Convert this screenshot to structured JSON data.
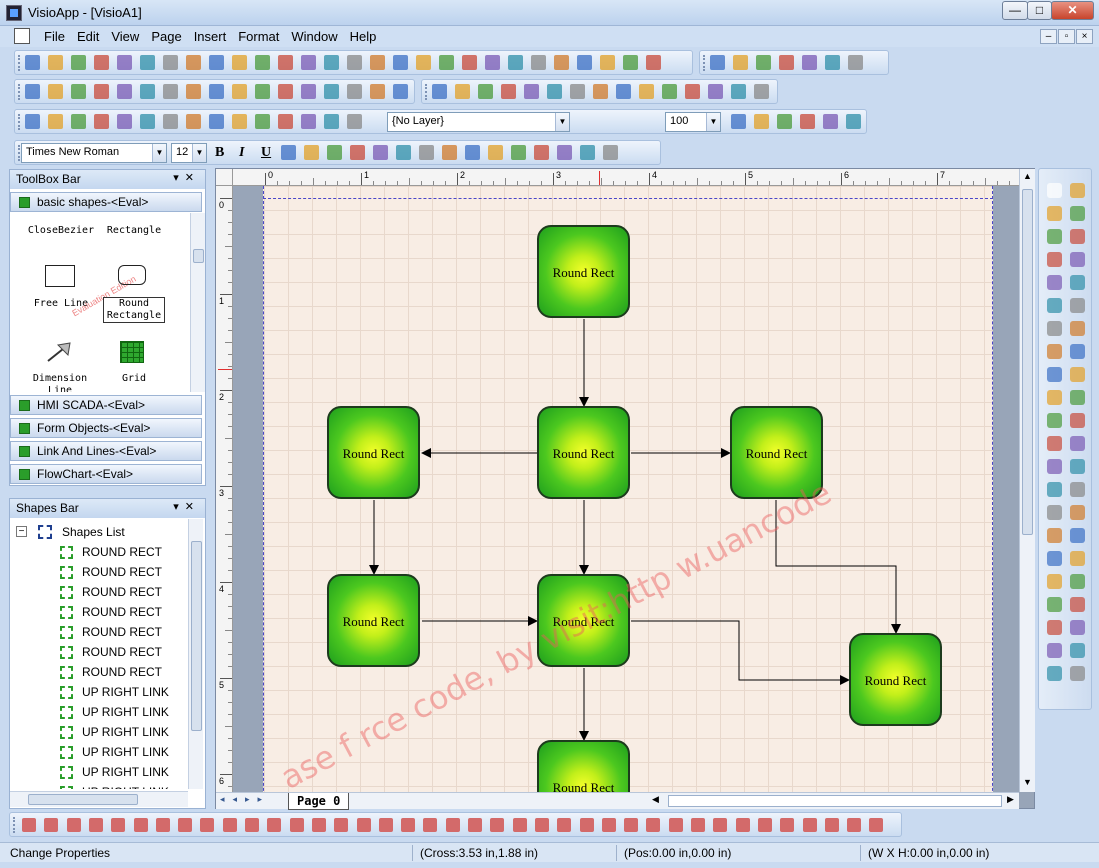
{
  "window": {
    "title": "VisioApp - [VisioA1]",
    "buttons": {
      "minimize": "—",
      "maximize": "□",
      "close": "✕"
    }
  },
  "menubar": {
    "items": [
      "File",
      "Edit",
      "View",
      "Page",
      "Insert",
      "Format",
      "Window",
      "Help"
    ],
    "mdi": {
      "minimize": "–",
      "restore": "▫",
      "close": "×"
    }
  },
  "toolbar3": {
    "layer_value": "{No Layer}",
    "zoom_value": "100"
  },
  "toolbar4": {
    "font_value": "Times New Roman",
    "size_value": "12",
    "bold": "B",
    "italic": "I",
    "underline": "U"
  },
  "toolbox": {
    "title": "ToolBox Bar",
    "active_category": "basic shapes-<Eval>",
    "shapes": [
      "CloseBezier",
      "Rectangle",
      "Free Line",
      "Round Rectangle",
      "Dimension Line",
      "Grid"
    ],
    "watermark": "Evaluation Edition",
    "categories": [
      "HMI SCADA-<Eval>",
      "Form Objects-<Eval>",
      "Link And Lines-<Eval>",
      "FlowChart-<Eval>"
    ]
  },
  "shapes_bar": {
    "title": "Shapes Bar",
    "root": "Shapes List",
    "items": [
      "ROUND RECT",
      "ROUND RECT",
      "ROUND RECT",
      "ROUND RECT",
      "ROUND RECT",
      "ROUND RECT",
      "ROUND RECT",
      "UP RIGHT LINK",
      "UP RIGHT LINK",
      "UP RIGHT LINK",
      "UP RIGHT LINK",
      "UP RIGHT LINK",
      "UP RIGHT LINK"
    ]
  },
  "canvas": {
    "ruler_h": [
      "0",
      "1",
      "2",
      "3",
      "4",
      "5",
      "6",
      "7"
    ],
    "ruler_v": [
      "0",
      "1",
      "2",
      "3",
      "4",
      "5",
      "6"
    ],
    "shape_label": "Round Rect",
    "watermark": "ase f   rce code, by visit:http   w.uancode",
    "page_tab": "Page   0"
  },
  "status": {
    "left": "Change Properties",
    "cross": "(Cross:3.53 in,1.88 in)",
    "pos": "(Pos:0.00 in,0.00 in)",
    "wxh": "(W X H:0.00 in,0.00 in)"
  },
  "colors": {
    "accent": "#2a9d2a",
    "shape_fill_center": "#f4ff2a",
    "shape_fill_edge": "#1d9e1d",
    "page_bg": "#f8ede4",
    "watermark": "#eb5a5a"
  }
}
